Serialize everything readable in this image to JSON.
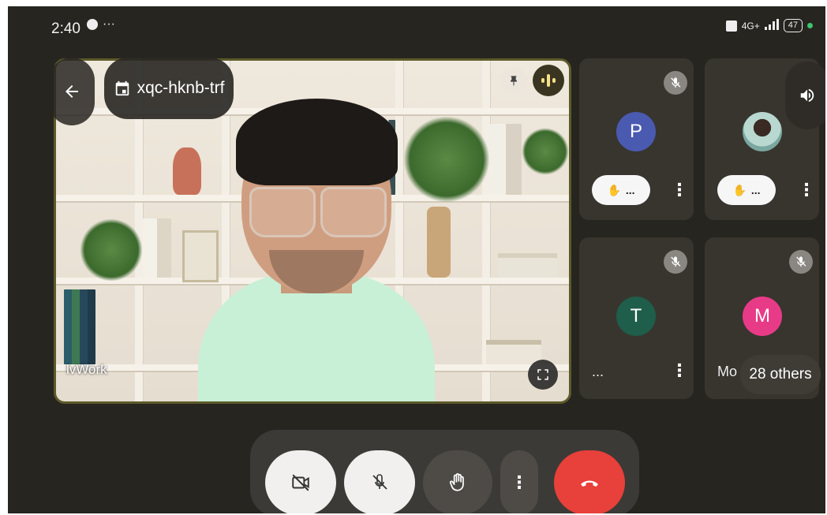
{
  "status_bar": {
    "time": "2:40",
    "overflow": "···",
    "network": "4G+",
    "battery": "47"
  },
  "main_video": {
    "meeting_code": "xqc-hknb-trf",
    "participant_name": "lvWork",
    "icons": [
      "back-arrow-icon",
      "calendar-icon",
      "pin-icon",
      "speaking-indicator-icon",
      "fullscreen-icon"
    ]
  },
  "tiles": [
    {
      "avatar_letter": "P",
      "avatar_color": "#4a5ab0",
      "muted": true,
      "name": "",
      "raise_label": "..."
    },
    {
      "avatar_letter": "",
      "avatar_color": "#7aa8a0",
      "muted": false,
      "name": "",
      "raise_label": "..."
    },
    {
      "avatar_letter": "T",
      "avatar_color": "#1f5e4a",
      "muted": true,
      "name": "...",
      "raise_label": ""
    },
    {
      "avatar_letter": "M",
      "avatar_color": "#e83b87",
      "muted": true,
      "name": "Mo",
      "raise_label": ""
    }
  ],
  "others": {
    "label": "28 others"
  },
  "controls": {
    "camera": "camera-off-icon",
    "mic": "mic-off-icon",
    "hand": "raise-hand-icon",
    "more": "more-vert-icon",
    "end_call": "call-end-icon",
    "end_call_color": "#e8403a"
  }
}
